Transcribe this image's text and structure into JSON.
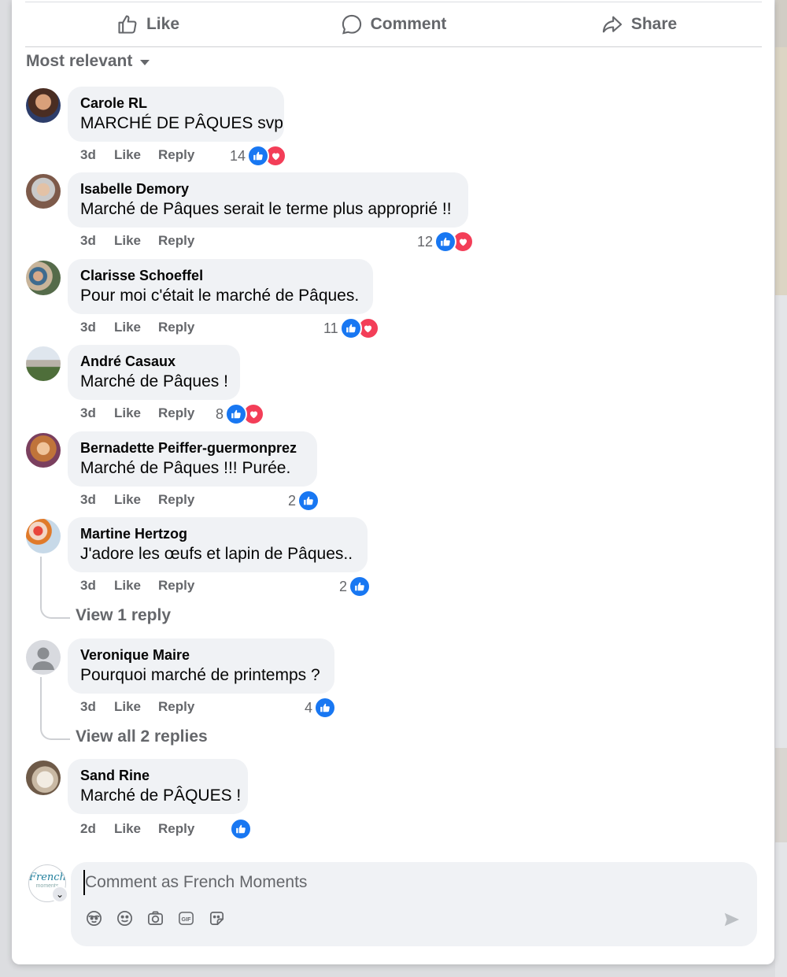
{
  "actions": {
    "like": "Like",
    "comment": "Comment",
    "share": "Share"
  },
  "sort_label": "Most relevant",
  "comments": [
    {
      "author": "Carole RL",
      "text": "MARCHÉ DE PÂQUES svp",
      "time": "3d",
      "like": "Like",
      "reply": "Reply",
      "reactions": "14"
    },
    {
      "author": "Isabelle Demory",
      "text": "Marché de Pâques serait le terme plus approprié !!",
      "time": "3d",
      "like": "Like",
      "reply": "Reply",
      "reactions": "12"
    },
    {
      "author": "Clarisse Schoeffel",
      "text": "Pour moi c'était le marché de Pâques.",
      "time": "3d",
      "like": "Like",
      "reply": "Reply",
      "reactions": "11"
    },
    {
      "author": "André Casaux",
      "text": "Marché de Pâques !",
      "time": "3d",
      "like": "Like",
      "reply": "Reply",
      "reactions": "8"
    },
    {
      "author": "Bernadette Peiffer-guermonprez",
      "text": "Marché de Pâques !!! Purée.",
      "time": "3d",
      "like": "Like",
      "reply": "Reply",
      "reactions": "2"
    },
    {
      "author": "Martine Hertzog",
      "text": "J'adore les œufs et lapin de Pâques..",
      "time": "3d",
      "like": "Like",
      "reply": "Reply",
      "reactions": "2",
      "view_replies": "View 1 reply"
    },
    {
      "author": "Veronique Maire",
      "text": "Pourquoi marché de printemps ?",
      "time": "3d",
      "like": "Like",
      "reply": "Reply",
      "reactions": "4",
      "view_replies": "View all 2 replies"
    },
    {
      "author": "Sand Rine",
      "text": "Marché de PÂQUES !",
      "time": "2d",
      "like": "Like",
      "reply": "Reply",
      "reactions": ""
    }
  ],
  "composer": {
    "placeholder": "Comment as French Moments",
    "avatar_text": "French",
    "avatar_subtext": "moments"
  },
  "icons": [
    "like-icon",
    "comment-icon",
    "share-icon",
    "avatar-sticker-icon",
    "emoji-icon",
    "camera-icon",
    "gif-icon",
    "sticker-icon",
    "send-icon"
  ],
  "colors": {
    "like_blue": "#1877f2",
    "love_red": "#f33e58",
    "bubble": "#f0f2f5",
    "muted_text": "#65676b"
  }
}
